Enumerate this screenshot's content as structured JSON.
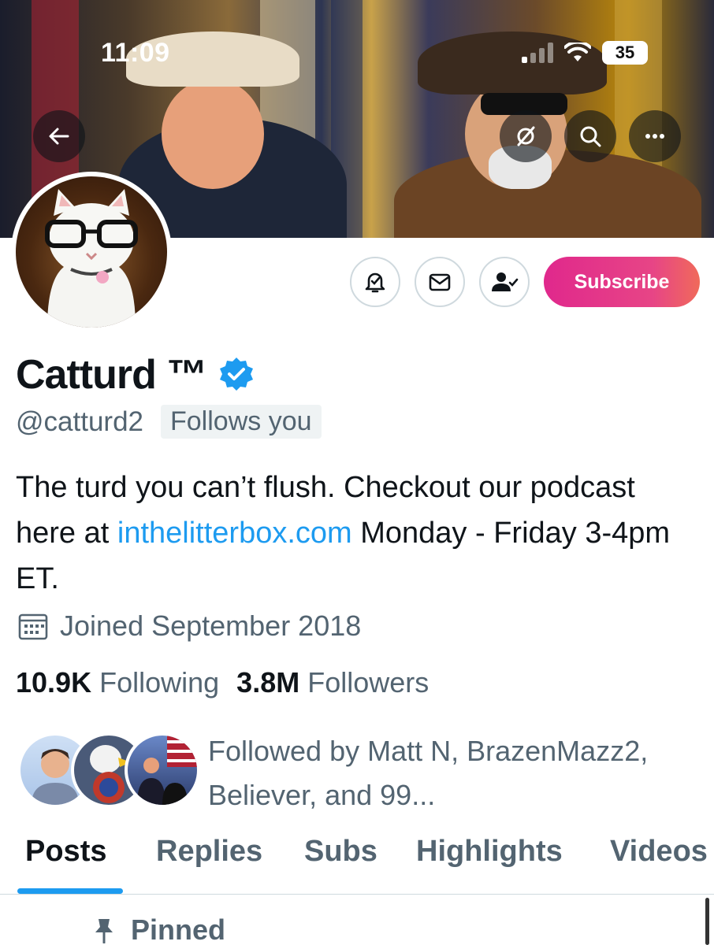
{
  "status_bar": {
    "time": "11:09",
    "battery": "35"
  },
  "banner_icons": {
    "back": "arrow-left-icon",
    "grok": "slash-circle-icon",
    "search": "search-icon",
    "more": "more-icon"
  },
  "actions": {
    "notify": "bell-icon",
    "message": "envelope-icon",
    "following": "person-check-icon",
    "subscribe_label": "Subscribe"
  },
  "profile": {
    "name": "Catturd ™",
    "handle": "@catturd2",
    "follows_you": "Follows you",
    "bio_part1": "The turd you can’t flush. Checkout our podcast here at ",
    "bio_link": "inthelitterbox.com",
    "bio_part2": " Monday - Friday 3-4pm ET.",
    "joined": "Joined September 2018",
    "following_count": "10.9K",
    "following_label": "Following",
    "followers_count": "3.8M",
    "followers_label": "Followers",
    "followed_by": "Followed by Matt N, BrazenMazz2, Believer, and 99..."
  },
  "tabs": [
    "Posts",
    "Replies",
    "Subs",
    "Highlights",
    "Videos"
  ],
  "pinned_label": "Pinned",
  "colors": {
    "accent": "#1d9bf0",
    "text_secondary": "#536471",
    "subscribe_gradient_start": "#e0288c",
    "subscribe_gradient_end": "#f06a5a"
  }
}
